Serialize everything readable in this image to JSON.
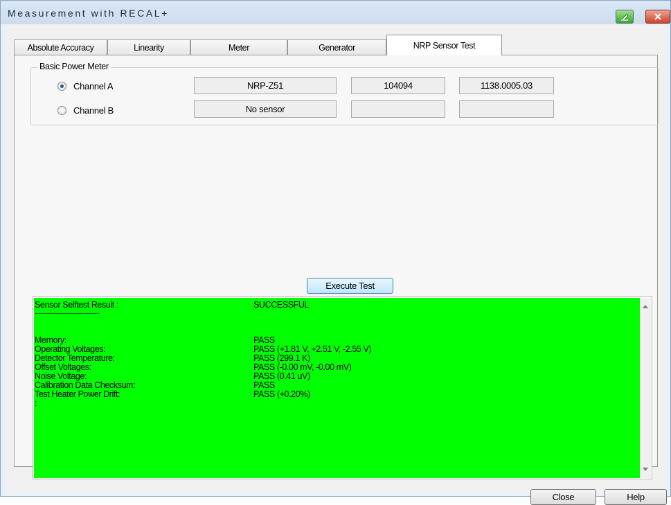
{
  "window": {
    "title": "Measurement with RECAL+",
    "accent_color": "#cddcee"
  },
  "tabs": [
    {
      "label": "Absolute Accuracy",
      "active": false
    },
    {
      "label": "Linearity",
      "active": false
    },
    {
      "label": "Meter",
      "active": false
    },
    {
      "label": "Generator",
      "active": false
    },
    {
      "label": "NRP Sensor Test",
      "active": true
    }
  ],
  "basic_power_meter": {
    "group_label": "Basic Power Meter",
    "channels": [
      {
        "label": "Channel A",
        "selected": true,
        "sensor": "NRP-Z51",
        "serial": "104094",
        "part_number": "1138.0005.03"
      },
      {
        "label": "Channel B",
        "selected": false,
        "sensor": "No sensor",
        "serial": "",
        "part_number": ""
      }
    ]
  },
  "execute_button": "Execute Test",
  "results": {
    "background_color": "#00ff00",
    "header_label": "Sensor Selftest Result :",
    "header_value": "SUCCESSFUL",
    "separator": "------------------------------------",
    "rows": [
      {
        "label": "Memory:",
        "value": "PASS"
      },
      {
        "label": "Operating Voltages:",
        "value": "PASS (+1.81 V, +2.51 V, -2.55 V)"
      },
      {
        "label": "Detector Temperature:",
        "value": "PASS (299.1 K)"
      },
      {
        "label": "Offset Voltages:",
        "value": "PASS (-0.00 mV, -0.00 mV)"
      },
      {
        "label": "Noise Voltage:",
        "value": "PASS (0.41 uV)"
      },
      {
        "label": "Calibration Data Checksum:",
        "value": "PASS"
      },
      {
        "label": "Test Heater Power Drift:",
        "value": "PASS (+0.20%)"
      }
    ],
    "trailing": ":"
  },
  "buttons": {
    "close": "Close",
    "help": "Help"
  },
  "icons": {
    "title_help": "help-icon",
    "title_close": "close-icon",
    "scroll_up": "scroll-up-arrow-icon",
    "scroll_down": "scroll-down-arrow-icon"
  }
}
